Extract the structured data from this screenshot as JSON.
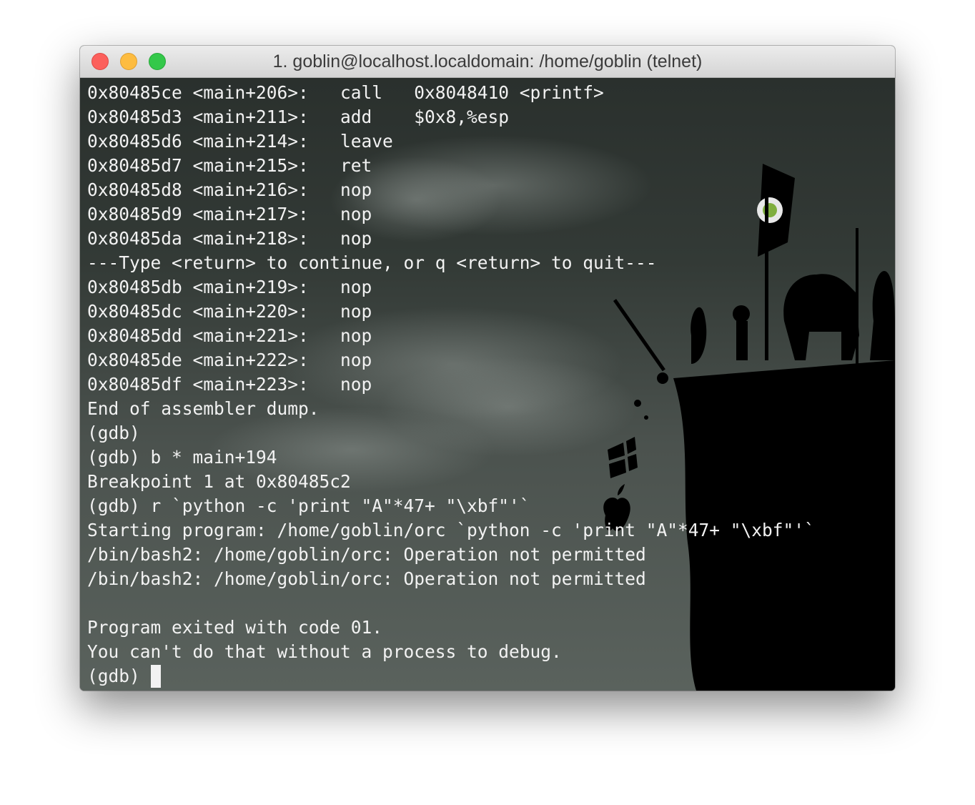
{
  "window": {
    "title": "1. goblin@localhost.localdomain: /home/goblin (telnet)"
  },
  "colors": {
    "close": "#fc605c",
    "minimize": "#fdbc40",
    "zoom": "#34c84a",
    "terminal_text": "#f2f2f2"
  },
  "terminal": {
    "lines": [
      "0x80485ce <main+206>:   call   0x8048410 <printf>",
      "0x80485d3 <main+211>:   add    $0x8,%esp",
      "0x80485d6 <main+214>:   leave",
      "0x80485d7 <main+215>:   ret",
      "0x80485d8 <main+216>:   nop",
      "0x80485d9 <main+217>:   nop",
      "0x80485da <main+218>:   nop",
      "---Type <return> to continue, or q <return> to quit---",
      "0x80485db <main+219>:   nop",
      "0x80485dc <main+220>:   nop",
      "0x80485dd <main+221>:   nop",
      "0x80485de <main+222>:   nop",
      "0x80485df <main+223>:   nop",
      "End of assembler dump.",
      "(gdb)",
      "(gdb) b * main+194",
      "Breakpoint 1 at 0x80485c2",
      "(gdb) r `python -c 'print \"A\"*47+ \"\\xbf\"'`",
      "Starting program: /home/goblin/orc `python -c 'print \"A\"*47+ \"\\xbf\"'`",
      "/bin/bash2: /home/goblin/orc: Operation not permitted",
      "/bin/bash2: /home/goblin/orc: Operation not permitted",
      "",
      "Program exited with code 01.",
      "You can't do that without a process to debug."
    ],
    "prompt": "(gdb) "
  },
  "icons": {
    "close": "close-button-icon",
    "minimize": "minimize-button-icon",
    "zoom": "zoom-button-icon",
    "wallpaper": "cliff-silhouette-wallpaper"
  }
}
